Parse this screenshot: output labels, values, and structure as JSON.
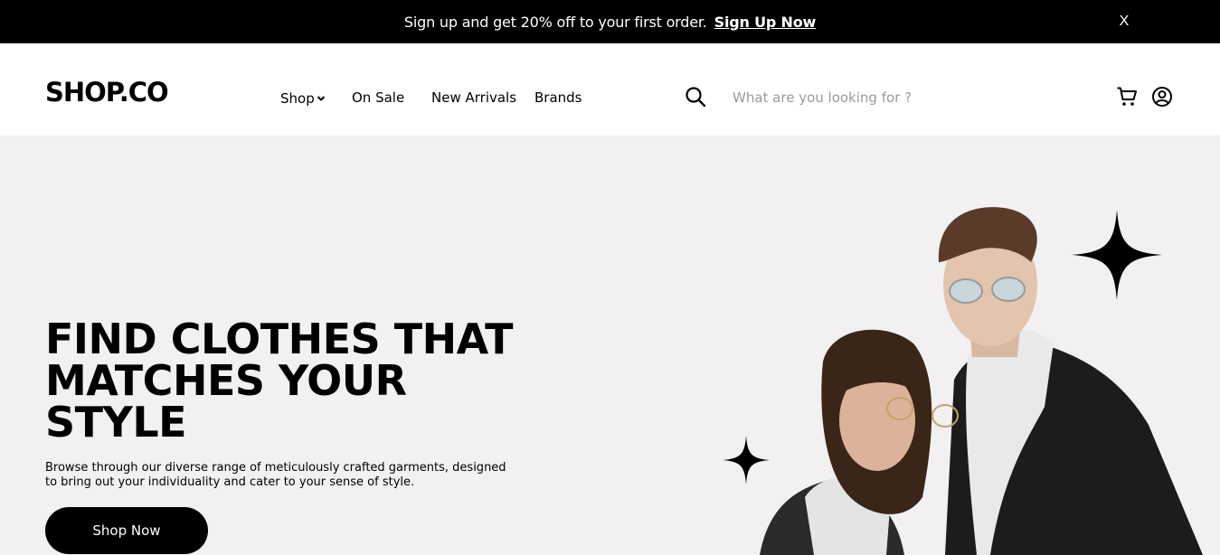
{
  "promo": {
    "message": "Sign up and get 20% off to your first order.",
    "cta": "Sign Up Now",
    "close": "X"
  },
  "header": {
    "logo": "SHOP.CO",
    "nav": [
      {
        "label": "Shop",
        "has_dropdown": true
      },
      {
        "label": "On Sale"
      },
      {
        "label": "New Arrivals"
      },
      {
        "label": "Brands"
      }
    ],
    "search": {
      "placeholder": "What are you looking for ?",
      "value": ""
    }
  },
  "hero": {
    "title": "FIND CLOTHES THAT MATCHES YOUR STYLE",
    "subtitle": "Browse through our diverse range of meticulously crafted garments, designed to bring out your individuality and cater to your sense of style.",
    "button": "Shop Now"
  },
  "icons": {
    "search": "search-icon",
    "cart": "cart-icon",
    "account": "account-icon",
    "dropdown": "chevron-down-icon",
    "star": "sparkle-star-icon"
  },
  "colors": {
    "promo_bg": "#000000",
    "hero_bg": "#f2f0f1",
    "button_bg": "#000000",
    "placeholder": "#9a9a9a"
  }
}
